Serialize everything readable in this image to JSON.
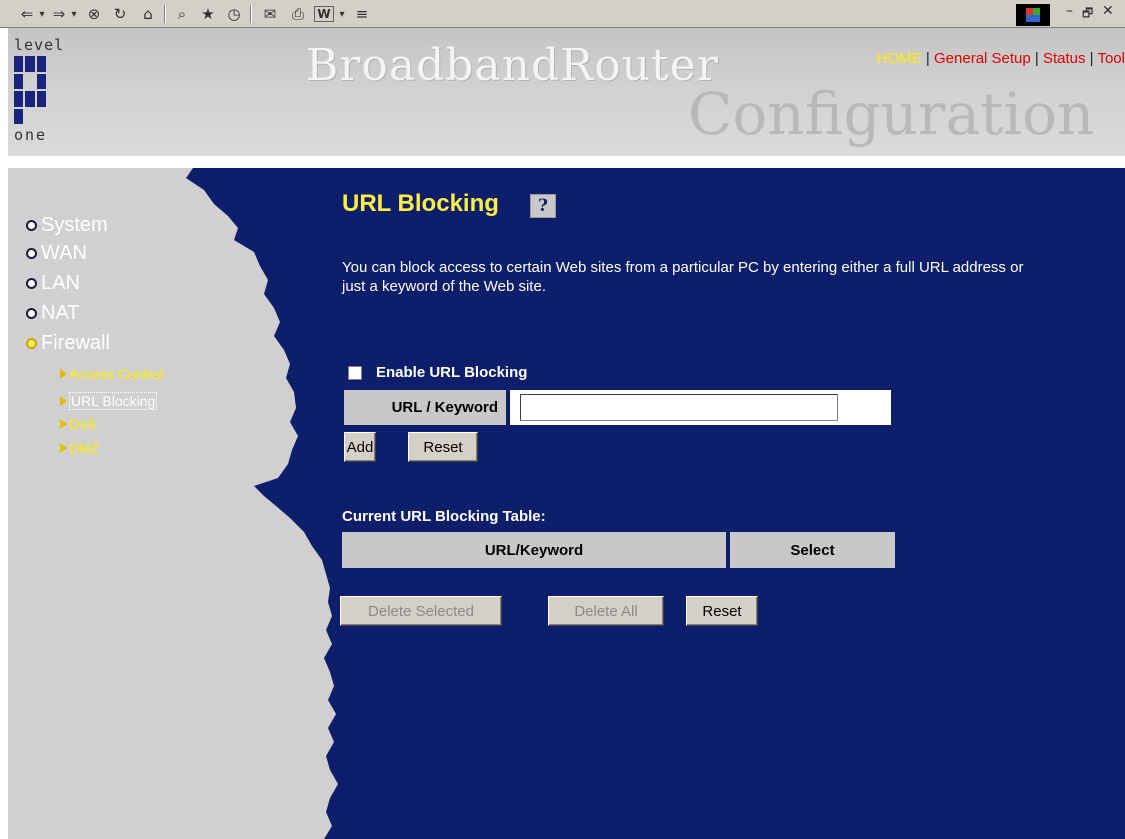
{
  "browser": {
    "toolbar_glyphs": [
      "⇐",
      "▾",
      "⇒",
      "▾",
      "⊗",
      "↻",
      "⌂",
      "⌕",
      "★",
      "◷",
      "✉",
      "⎙",
      "W",
      "▾",
      "≡"
    ],
    "window_controls": [
      "–",
      "🗗",
      "✕"
    ]
  },
  "header": {
    "logo_top": "level",
    "logo_bottom": "one",
    "title_main": "BroadbandRouter",
    "title_sub": "Configuration",
    "nav": {
      "home": "HOME",
      "sep": " | ",
      "general_setup": "General Setup",
      "status": "Status",
      "tool": "Tool"
    },
    "colors": {
      "home": "#ffee00",
      "links": "#e00000"
    }
  },
  "sidebar": {
    "items": [
      {
        "label": "System"
      },
      {
        "label": "WAN"
      },
      {
        "label": "LAN"
      },
      {
        "label": "NAT"
      },
      {
        "label": "Firewall"
      }
    ],
    "subitems": [
      {
        "label": "Access Control"
      },
      {
        "label": "URL Blocking"
      },
      {
        "label": "DoS"
      },
      {
        "label": "DMZ"
      }
    ],
    "selected_item": "Firewall",
    "selected_subitem": "URL Blocking"
  },
  "main": {
    "title": "URL Blocking",
    "help_glyph": "?",
    "description": "You can block access to certain Web sites from a particular PC by entering either a full URL address or just a keyword of the Web site.",
    "enable_label": "Enable URL Blocking",
    "enable_checked": false,
    "keyword_label": "URL / Keyword",
    "keyword_value": "",
    "add_label": "Add",
    "reset_label": "Reset",
    "table_caption": "Current URL Blocking Table:",
    "table_headers": [
      "URL/Keyword",
      "Select"
    ],
    "delete_selected_label": "Delete Selected",
    "delete_all_label": "Delete All",
    "reset2_label": "Reset",
    "colors": {
      "background": "#0d1f6b",
      "title": "#ffee44",
      "sidebar": "#d0d0d0"
    }
  }
}
